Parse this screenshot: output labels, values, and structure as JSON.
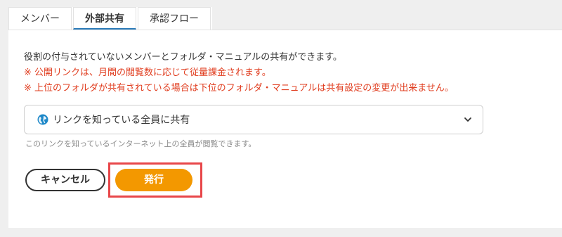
{
  "tabs": [
    {
      "label": "メンバー"
    },
    {
      "label": "外部共有"
    },
    {
      "label": "承認フロー"
    }
  ],
  "description": {
    "line1": "役割の付与されていないメンバーとフォルダ・マニュアルの共有ができます。",
    "note1": "※ 公開リンクは、月間の閲覧数に応じて従量課金されます。",
    "note2": "※ 上位のフォルダが共有されている場合は下位のフォルダ・マニュアルは共有設定の変更が出来ません。"
  },
  "share_select": {
    "value": "リンクを知っている全員に共有",
    "icon": "globe-icon"
  },
  "helper_text": "このリンクを知っているインターネット上の全員が閲覧できます。",
  "buttons": {
    "cancel": "キャンセル",
    "publish": "発行"
  },
  "colors": {
    "accent_orange": "#f39800",
    "warning_red": "#e03c1e",
    "highlight_border": "#e8474a",
    "tab_active_underline": "#2a7ab8"
  }
}
